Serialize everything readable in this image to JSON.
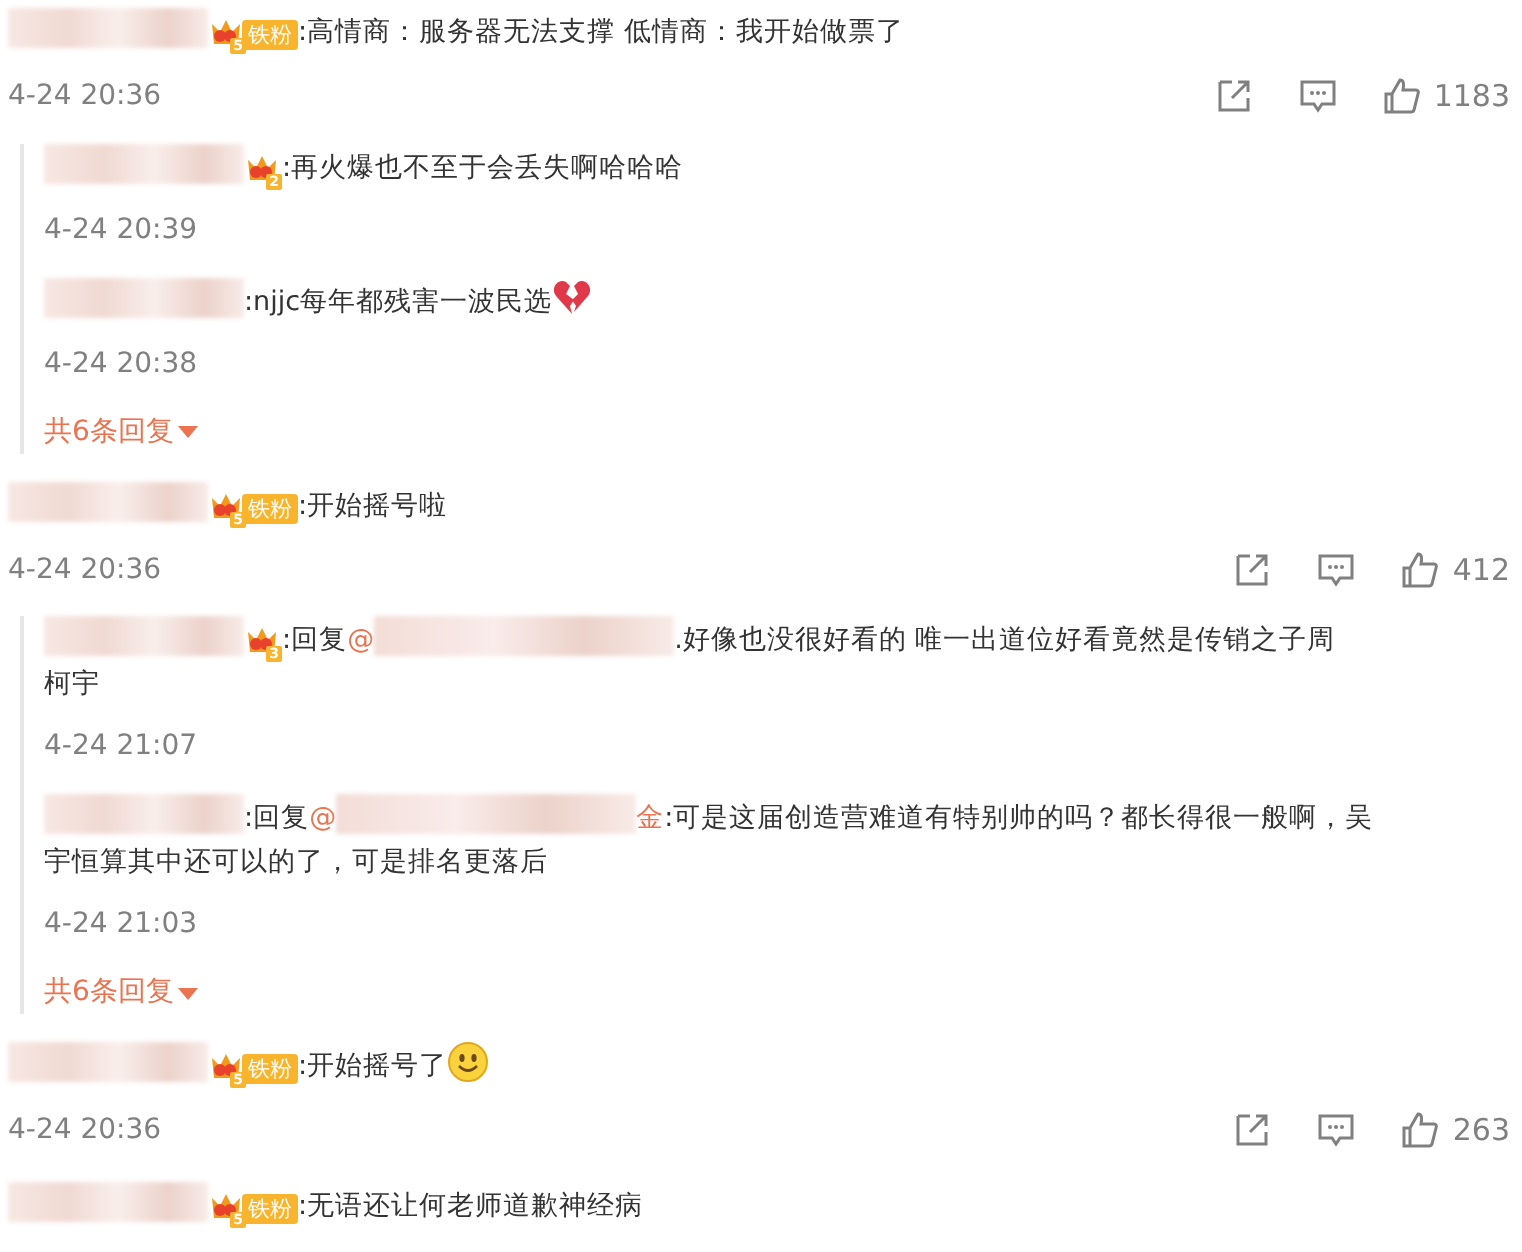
{
  "comments": [
    {
      "badge": {
        "level": "5",
        "label": "铁粉"
      },
      "parts": [
        {
          "kind": "text",
          "text": ":高情商：服务器无法支撑 低情商：我开始做票了"
        }
      ],
      "time": "4-24 20:36",
      "likes": "1183",
      "replies": [
        {
          "badge": {
            "level": "2"
          },
          "parts": [
            {
              "kind": "text",
              "text": ":再火爆也不至于会丢失啊哈哈哈"
            }
          ],
          "time": "4-24 20:39"
        },
        {
          "parts": [
            {
              "kind": "text",
              "text": ":njjc每年都残害一波民选"
            },
            {
              "kind": "broken-heart-emoji"
            }
          ],
          "time": "4-24 20:38"
        }
      ],
      "more_replies": "共6条回复"
    },
    {
      "badge": {
        "level": "5",
        "label": "铁粉"
      },
      "parts": [
        {
          "kind": "text",
          "text": ":开始摇号啦"
        }
      ],
      "time": "4-24 20:36",
      "likes": "412",
      "replies": [
        {
          "badge": {
            "level": "3"
          },
          "parts": [
            {
              "kind": "text",
              "text": ":回复"
            },
            {
              "kind": "mention",
              "at": "@"
            },
            {
              "kind": "text",
              "text": ".好像也没很好看的 唯一出道位好看竟然是传销之子周"
            },
            {
              "kind": "break"
            },
            {
              "kind": "text",
              "text": "柯宇"
            }
          ],
          "time": "4-24 21:07"
        },
        {
          "parts": [
            {
              "kind": "text",
              "text": ":回复"
            },
            {
              "kind": "mention",
              "at": "@",
              "tail": "金"
            },
            {
              "kind": "text",
              "text": ":可是这届创造营难道有特别帅的吗？都长得很一般啊，吴"
            },
            {
              "kind": "break"
            },
            {
              "kind": "text",
              "text": "宇恒算其中还可以的了，可是排名更落后"
            }
          ],
          "time": "4-24 21:03"
        }
      ],
      "more_replies": "共6条回复"
    },
    {
      "badge": {
        "level": "5",
        "label": "铁粉"
      },
      "parts": [
        {
          "kind": "text",
          "text": ":开始摇号了"
        },
        {
          "kind": "smile-emoji"
        }
      ],
      "time": "4-24 20:36",
      "likes": "263"
    },
    {
      "badge": {
        "level": "5",
        "label": "铁粉"
      },
      "parts": [
        {
          "kind": "text",
          "text": ":无语还让何老师道歉神经病"
        }
      ]
    }
  ]
}
